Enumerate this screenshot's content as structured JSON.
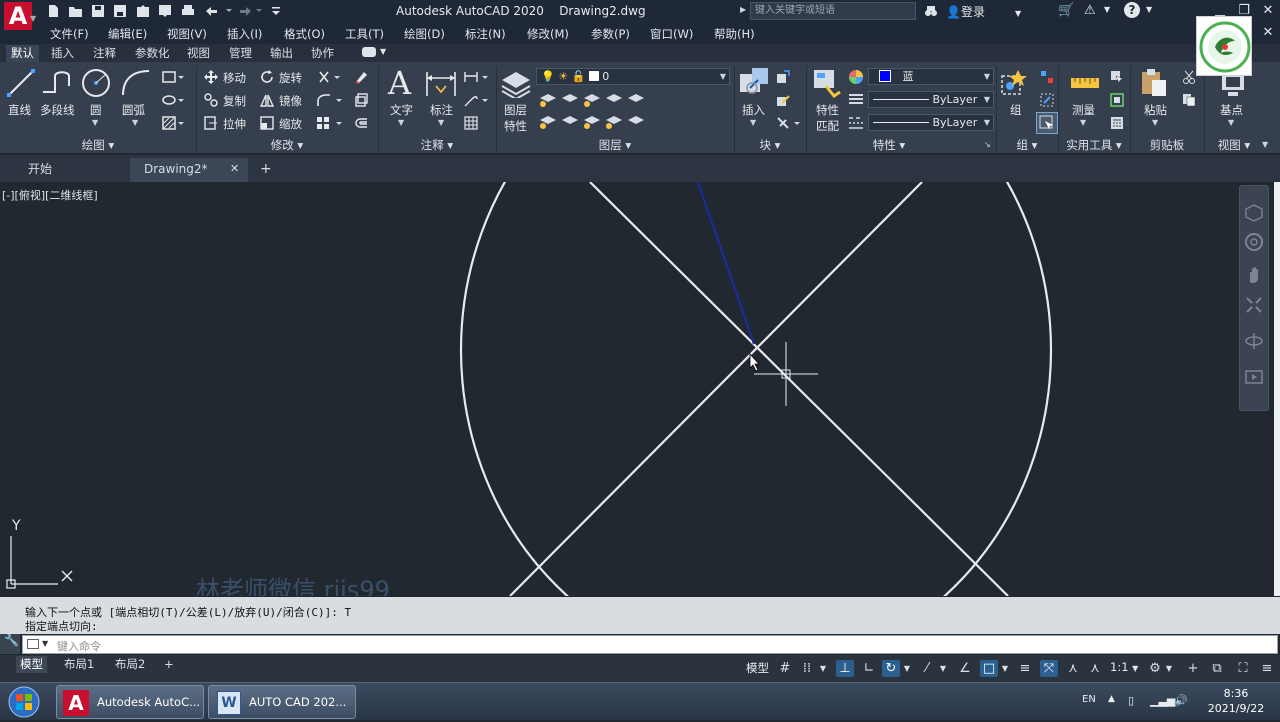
{
  "titlebar": {
    "app_title": "Autodesk AutoCAD 2020",
    "doc_title": "Drawing2.dwg",
    "search_placeholder": "键入关键字或短语",
    "signin_label": "登录"
  },
  "menu": [
    "文件(F)",
    "编辑(E)",
    "视图(V)",
    "插入(I)",
    "格式(O)",
    "工具(T)",
    "绘图(D)",
    "标注(N)",
    "修改(M)",
    "参数(P)",
    "窗口(W)",
    "帮助(H)"
  ],
  "ribbon_tabs": [
    "默认",
    "插入",
    "注释",
    "参数化",
    "视图",
    "管理",
    "输出",
    "协作"
  ],
  "ribbon": {
    "draw": {
      "line": "直线",
      "polyline": "多段线",
      "circle": "圆",
      "arc": "圆弧",
      "title": "绘图"
    },
    "modify": {
      "move": "移动",
      "rotate": "旋转",
      "copy": "复制",
      "mirror": "镜像",
      "stretch": "拉伸",
      "scale": "缩放",
      "title": "修改"
    },
    "annotation": {
      "text": "文字",
      "dimension": "标注",
      "title": "注释"
    },
    "layers": {
      "layer_props": "图层",
      "layer_props2": "特性",
      "current_layer": "0",
      "title": "图层"
    },
    "block": {
      "insert": "插入",
      "title": "块"
    },
    "properties": {
      "match": "特性",
      "match2": "匹配",
      "color_name": "蓝",
      "linetype": "ByLayer",
      "lineweight": "ByLayer",
      "title": "特性"
    },
    "groups": {
      "group": "组",
      "title": "组"
    },
    "utilities": {
      "measure": "测量",
      "title": "实用工具"
    },
    "clipboard": {
      "paste": "粘贴",
      "title": "剪贴板"
    },
    "view": {
      "base": "基点",
      "title": "视图"
    }
  },
  "doc_tabs": {
    "start": "开始",
    "drawing": "Drawing2*",
    "add": "+"
  },
  "viewport_label": "[-][俯视][二维线框]",
  "ucs": {
    "y": "Y"
  },
  "watermark": "林老师微信 rjjs99",
  "command": {
    "history_1": "输入下一个点或 [端点相切(T)/公差(L)/放弃(U)/闭合(C)]: T",
    "history_2": "指定端点切向:",
    "placeholder": "键入命令"
  },
  "layout_tabs": [
    "模型",
    "布局1",
    "布局2",
    "+"
  ],
  "status": {
    "model": "模型",
    "scale": "1:1"
  },
  "taskbar": {
    "task1": "Autodesk AutoC...",
    "task2": "AUTO  CAD 202...",
    "lang": "EN",
    "time": "8:36",
    "date": "2021/9/22"
  },
  "colors": {
    "accent_blue": "#0000ff",
    "canvas": "#212830",
    "ribbon": "#353f4d",
    "logo_red": "#c8102e"
  }
}
